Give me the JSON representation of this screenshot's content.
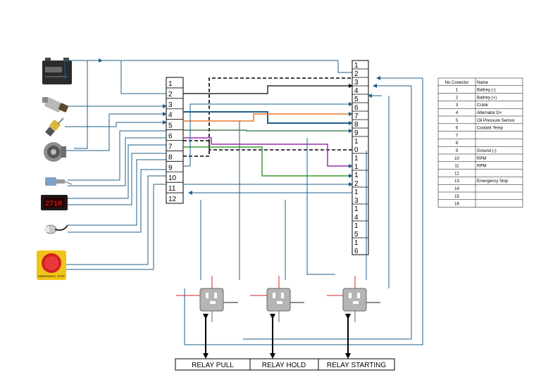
{
  "left_terminal": {
    "pins": [
      "1",
      "2",
      "3",
      "4",
      "5",
      "6",
      "7",
      "8",
      "9",
      "10",
      "11",
      "12"
    ]
  },
  "right_terminal": {
    "pins": [
      "1",
      "2",
      "3",
      "4",
      "5",
      "6",
      "7",
      "8",
      "9",
      "10",
      "11",
      "12",
      "13",
      "14",
      "15",
      "16"
    ]
  },
  "components": [
    {
      "id": "battery",
      "icon": "battery-icon"
    },
    {
      "id": "oil-pressure-sensor",
      "icon": "oil-pressure-sensor-icon"
    },
    {
      "id": "coolant-temp-sensor",
      "icon": "coolant-temp-sensor-icon"
    },
    {
      "id": "alternator",
      "icon": "alternator-icon"
    },
    {
      "id": "rpm-sensor",
      "icon": "rpm-sensor-icon"
    },
    {
      "id": "rpm-display",
      "icon": "digital-display-icon",
      "display_value": "2710"
    },
    {
      "id": "pickup-sensor",
      "icon": "pickup-sensor-icon"
    },
    {
      "id": "emergency-stop",
      "icon": "emergency-stop-button-icon",
      "label": "EMERGENCY STOP"
    }
  ],
  "pin_table": {
    "headers": [
      "No Conector",
      "Name"
    ],
    "rows": [
      [
        "1",
        "Battrey (-)"
      ],
      [
        "2",
        "Battrey (+)"
      ],
      [
        "3",
        "Crank"
      ],
      [
        "4",
        "Alternator D+"
      ],
      [
        "5",
        "Oil Pressure Sensor"
      ],
      [
        "6",
        "Coolant Temp"
      ],
      [
        "7",
        ""
      ],
      [
        "8",
        ""
      ],
      [
        "9",
        "Ground (-)"
      ],
      [
        "10",
        "RPM"
      ],
      [
        "11",
        "RPM"
      ],
      [
        "12",
        ""
      ],
      [
        "13",
        "Emergency Stop"
      ],
      [
        "14",
        ""
      ],
      [
        "15",
        ""
      ],
      [
        "16",
        ""
      ]
    ]
  },
  "relays": [
    {
      "label": "RELAY PULL"
    },
    {
      "label": "RELAY HOLD"
    },
    {
      "label": "RELAY STARTING"
    }
  ],
  "colors": {
    "wire_default": "#1f5f8b",
    "wire_orange": "#e87722",
    "wire_purple": "#9b2fae",
    "wire_green": "#3a9a2f",
    "wire_darkgreen": "#2e6b3a",
    "wire_black": "#000000",
    "relay_body": "#b5b5b5",
    "estop_red": "#d42020",
    "estop_yellow": "#f0c419"
  }
}
